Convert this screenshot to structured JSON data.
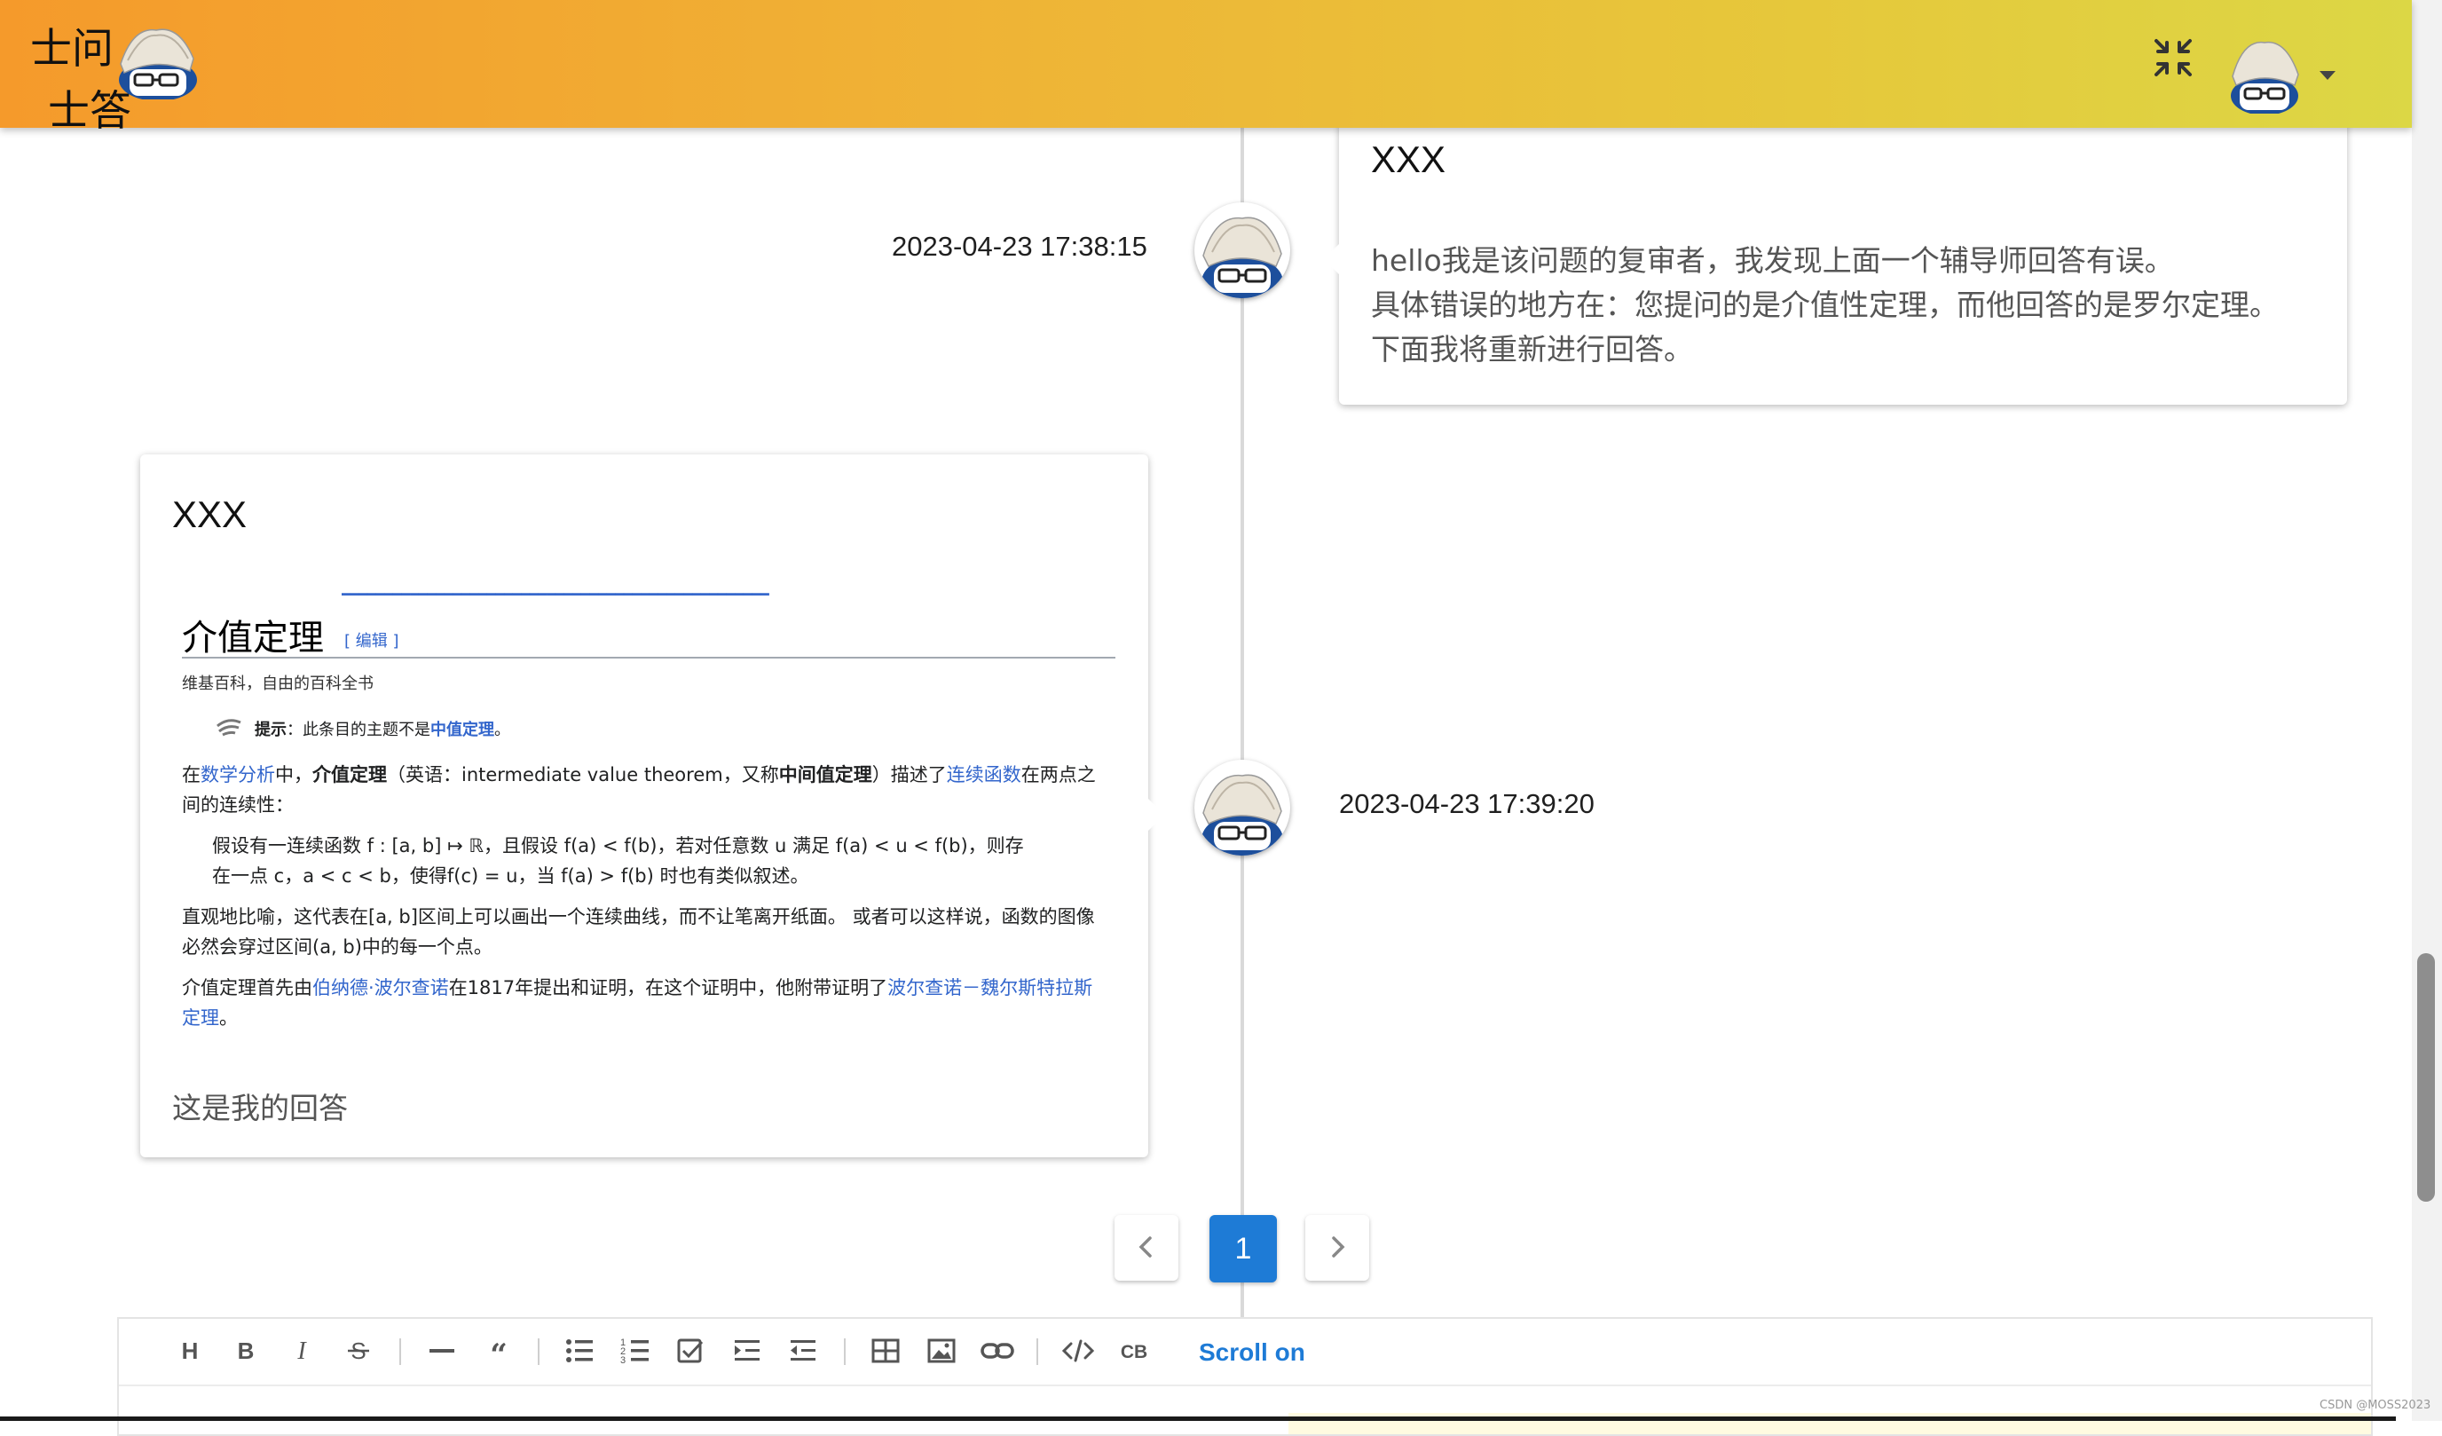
{
  "header": {
    "logo_line1": "士问",
    "logo_line2": "士答",
    "icons": {
      "fullscreen": "fullscreen-exit-icon",
      "avatar": "mascot-avatar",
      "menu": "caret-down-icon"
    }
  },
  "timeline": {
    "entries": [
      {
        "timestamp": "2023-04-23 17:38:15",
        "title": "XXX",
        "body_lines": [
          "hello我是该问题的复审者，我发现上面一个辅导师回答有误。",
          "具体错误的地方在：您提问的是介值性定理，而他回答的是罗尔定理。",
          "下面我将重新进行回答。"
        ]
      },
      {
        "timestamp": "2023-04-23 17:39:20",
        "title": "XXX",
        "footer": "这是我的回答",
        "wiki": {
          "title": "介值定理",
          "edit_link": "[ 编辑 ]",
          "subtitle": "维基百科，自由的百科全书",
          "hint_label": "提示",
          "hint_text": "：此条目的主题不是",
          "hint_link": "中值定理",
          "hint_end": "。",
          "p1_a": "在",
          "p1_link1": "数学分析",
          "p1_b": "中，",
          "p1_bold1": "介值定理",
          "p1_c": "（英语：intermediate value theorem，又称",
          "p1_bold2": "中间值定理",
          "p1_d": "）描述了",
          "p1_link2": "连续函数",
          "p1_e": "在两点之",
          "p1_line2": "间的连续性：",
          "p2_line1": "假设有一连续函数 f : [a, b] ↦ ℝ，且假设 f(a) < f(b)，若对任意数 u 满足 f(a) < u < f(b)，则存",
          "p2_line2": "在一点 c，a < c < b，使得f(c) = u，当 f(a) > f(b) 时也有类似叙述。",
          "p3_line1": "直观地比喻，这代表在[a, b]区间上可以画出一个连续曲线，而不让笔离开纸面。 或者可以这样说，函数的图像",
          "p3_line2": "必然会穿过区间(a, b)中的每一个点。",
          "p4_a": "介值定理首先由",
          "p4_link1": "伯纳德·波尔查诺",
          "p4_b": "在1817年提出和证明，在这个证明中，他附带证明了",
          "p4_link2": "波尔查诺－魏尔斯特拉斯",
          "p4_link3": "定理",
          "p4_end": "。"
        }
      }
    ]
  },
  "pagination": {
    "current": "1",
    "prev_icon": "chevron-left-icon",
    "next_icon": "chevron-right-icon"
  },
  "editor": {
    "toolbar": [
      "heading",
      "bold",
      "italic",
      "strikethrough",
      "horizontal-rule",
      "quote",
      "bullet-list",
      "ordered-list",
      "task-list",
      "indent",
      "outdent",
      "table",
      "image",
      "link",
      "code",
      "code-block"
    ],
    "scroll_label": "Scroll on"
  },
  "watermark": "CSDN @MOSS2023",
  "colors": {
    "header_start": "#f59a2b",
    "header_end": "#dcd745",
    "accent": "#1e7bd6",
    "link": "#3366cc"
  }
}
